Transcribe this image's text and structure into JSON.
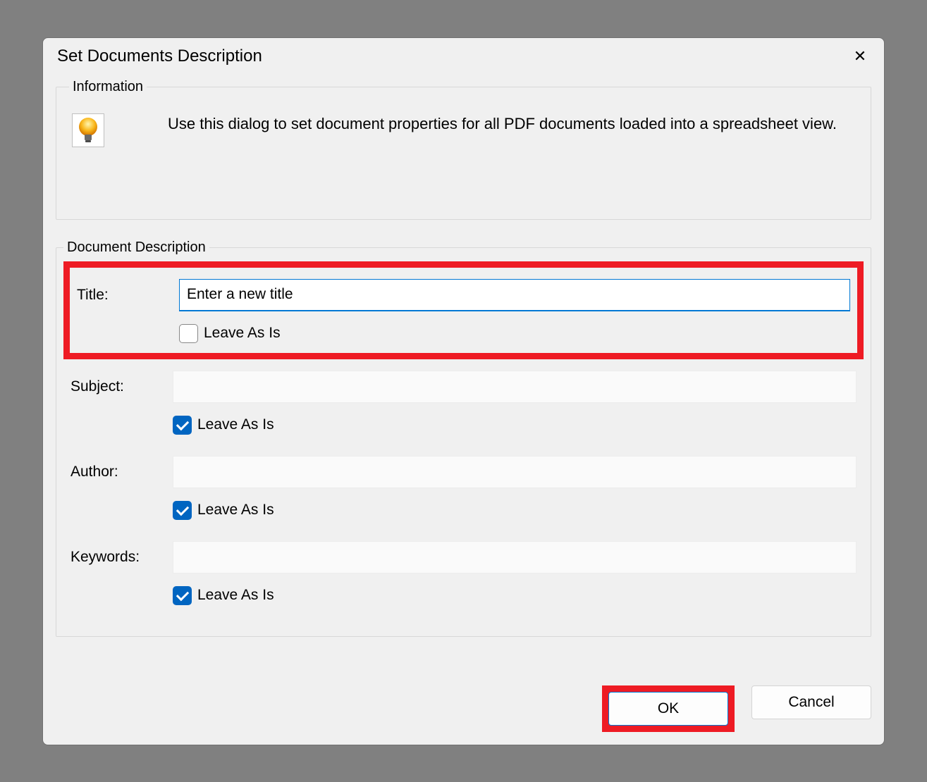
{
  "dialog": {
    "title": "Set Documents Description",
    "close_label": "✕"
  },
  "info": {
    "legend": "Information",
    "text": "Use this dialog to set document properties for all PDF documents loaded into a spreadsheet view."
  },
  "desc": {
    "legend": "Document Description",
    "fields": {
      "title": {
        "label": "Title:",
        "value": "Enter a new title",
        "leave_as_is_label": "Leave As Is",
        "leave_as_is_checked": false
      },
      "subject": {
        "label": "Subject:",
        "value": "",
        "leave_as_is_label": "Leave As Is",
        "leave_as_is_checked": true
      },
      "author": {
        "label": "Author:",
        "value": "",
        "leave_as_is_label": "Leave As Is",
        "leave_as_is_checked": true
      },
      "keywords": {
        "label": "Keywords:",
        "value": "",
        "leave_as_is_label": "Leave As Is",
        "leave_as_is_checked": true
      }
    }
  },
  "buttons": {
    "ok": "OK",
    "cancel": "Cancel"
  }
}
